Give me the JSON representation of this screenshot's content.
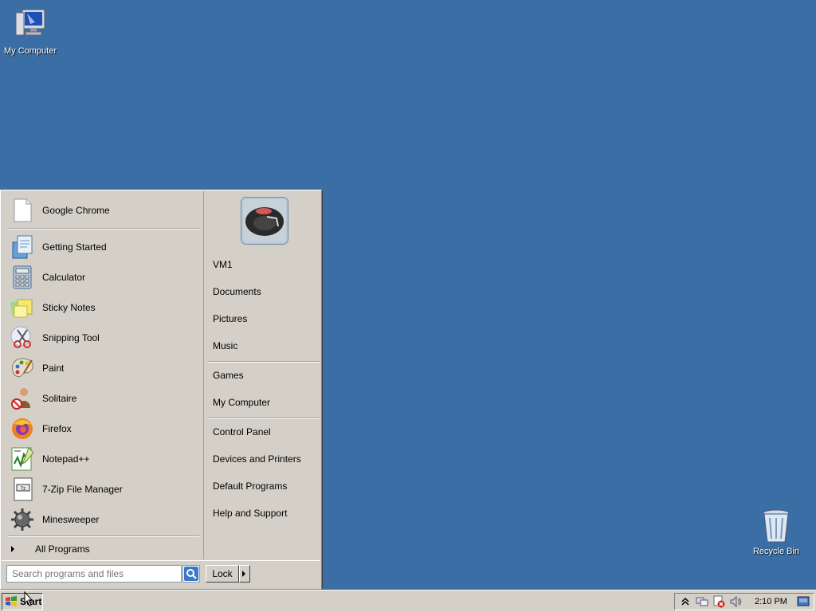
{
  "desktop": {
    "icons": [
      {
        "label": "My Computer",
        "icon": "my-computer-icon"
      },
      {
        "label": "Recycle Bin",
        "icon": "recycle-bin-icon"
      }
    ],
    "background_color": "#3a6ea5"
  },
  "start_menu": {
    "pinned": [
      {
        "label": "Google Chrome",
        "icon": "blank-document-icon"
      }
    ],
    "recent": [
      {
        "label": "Getting Started",
        "icon": "getting-started-icon"
      },
      {
        "label": "Calculator",
        "icon": "calculator-icon"
      },
      {
        "label": "Sticky Notes",
        "icon": "sticky-notes-icon"
      },
      {
        "label": "Snipping Tool",
        "icon": "scissors-icon"
      },
      {
        "label": "Paint",
        "icon": "paint-palette-icon"
      },
      {
        "label": "Solitaire",
        "icon": "solitaire-icon"
      },
      {
        "label": "Firefox",
        "icon": "firefox-icon"
      },
      {
        "label": "Notepad++",
        "icon": "notepad-plus-icon"
      },
      {
        "label": "7-Zip File Manager",
        "icon": "seven-zip-icon"
      },
      {
        "label": "Minesweeper",
        "icon": "mine-icon"
      }
    ],
    "all_programs_label": "All Programs",
    "search_placeholder": "Search programs and files",
    "right_items": [
      {
        "label": "VM1"
      },
      {
        "label": "Documents"
      },
      {
        "label": "Pictures"
      },
      {
        "label": "Music"
      },
      {
        "label": "Games"
      },
      {
        "label": "My Computer"
      },
      {
        "label": "Control Panel"
      },
      {
        "label": "Devices and Printers"
      },
      {
        "label": "Default Programs"
      },
      {
        "label": "Help and Support"
      }
    ],
    "lock_label": "Lock"
  },
  "taskbar": {
    "start_label": "Start",
    "clock": "2:10 PM",
    "tray_icons": [
      "show-hidden-icons-chevron-icon",
      "network-icon",
      "action-center-error-icon",
      "volume-icon",
      "show-desktop-icon"
    ]
  }
}
